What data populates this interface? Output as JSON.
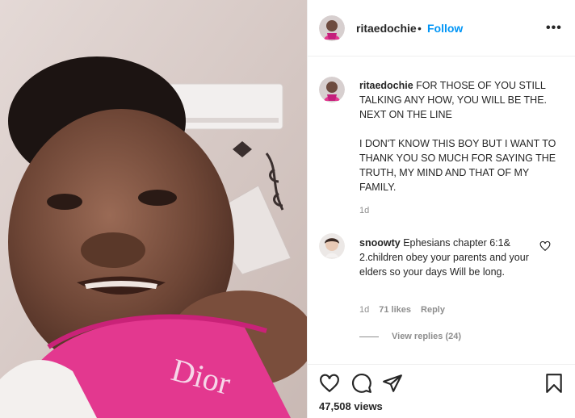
{
  "post": {
    "username": "ritaedochie",
    "dot": "•",
    "follow_label": "Follow",
    "more_label": "•••"
  },
  "caption": {
    "username": "ritaedochie",
    "text": "FOR THOSE OF YOU STILL TALKING ANY HOW, YOU WILL BE THE. NEXT ON THE LINE\n\nI DON'T KNOW THIS BOY BUT I WANT TO THANK YOU SO MUCH FOR SAYING THE TRUTH, MY MIND AND THAT OF MY FAMILY.",
    "time": "1d"
  },
  "comment": {
    "username": "snoowty",
    "text": "Ephesians chapter 6:1& 2.children obey your parents and your elders so your days Will be long.",
    "time": "1d",
    "likes": "71 likes",
    "reply_label": "Reply",
    "view_replies": "View replies (24)"
  },
  "footer": {
    "views": "47,508 views"
  },
  "media": {
    "shirt_text": "Dior"
  },
  "icons": {
    "heart": "heart-icon",
    "comment": "comment-icon",
    "share": "paper-plane-icon",
    "save": "bookmark-icon",
    "more": "ellipsis-icon"
  },
  "colors": {
    "follow": "#0095f6",
    "text": "#262626",
    "muted": "#8e8e8e",
    "shirt_pink": "#e3388f"
  }
}
